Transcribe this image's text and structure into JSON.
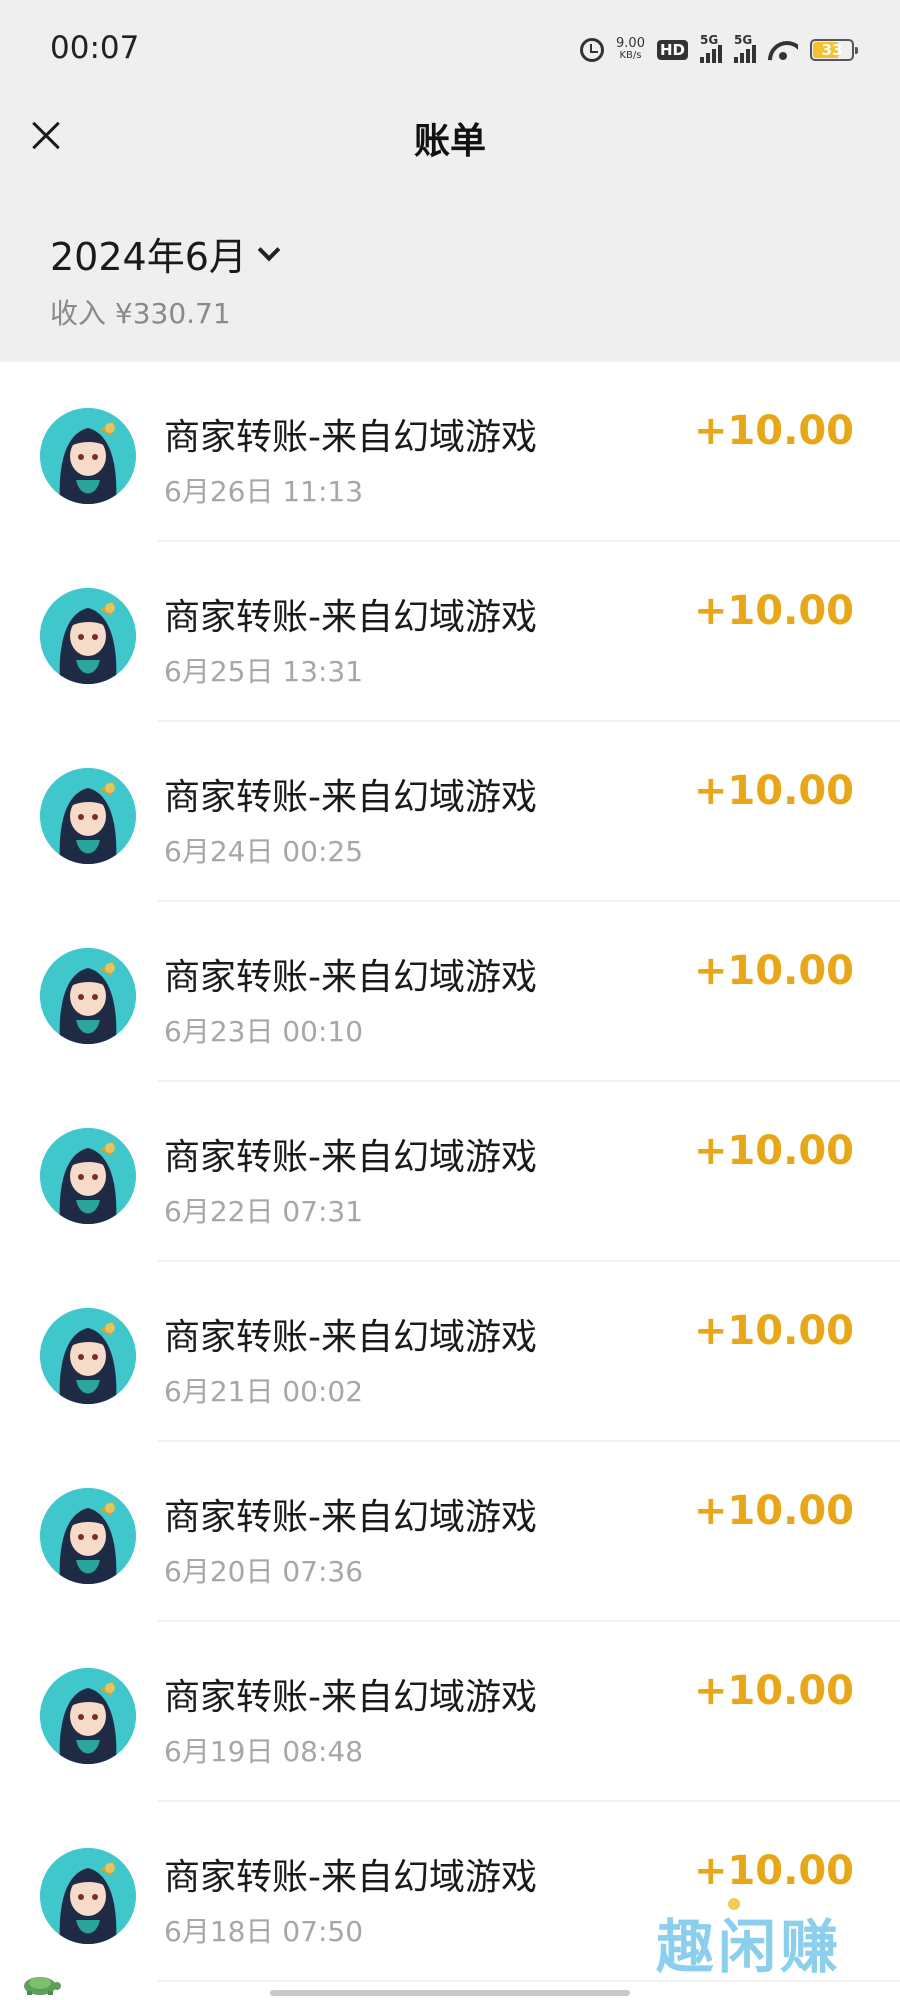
{
  "status_bar": {
    "time": "00:07",
    "net_speed_value": "9.00",
    "net_speed_unit": "KB/s",
    "hd_label": "HD",
    "sim1_label": "5G",
    "sim2_label": "5G",
    "battery_level": "33"
  },
  "header": {
    "title": "账单"
  },
  "summary": {
    "month": "2024年6月",
    "income": "收入 ¥330.71"
  },
  "transactions": [
    {
      "title": "商家转账-来自幻域游戏",
      "time": "6月26日 11:13",
      "amount": "+10.00"
    },
    {
      "title": "商家转账-来自幻域游戏",
      "time": "6月25日 13:31",
      "amount": "+10.00"
    },
    {
      "title": "商家转账-来自幻域游戏",
      "time": "6月24日 00:25",
      "amount": "+10.00"
    },
    {
      "title": "商家转账-来自幻域游戏",
      "time": "6月23日 00:10",
      "amount": "+10.00"
    },
    {
      "title": "商家转账-来自幻域游戏",
      "time": "6月22日 07:31",
      "amount": "+10.00"
    },
    {
      "title": "商家转账-来自幻域游戏",
      "time": "6月21日 00:02",
      "amount": "+10.00"
    },
    {
      "title": "商家转账-来自幻域游戏",
      "time": "6月20日 07:36",
      "amount": "+10.00"
    },
    {
      "title": "商家转账-来自幻域游戏",
      "time": "6月19日 08:48",
      "amount": "+10.00"
    },
    {
      "title": "商家转账-来自幻域游戏",
      "time": "6月18日 07:50",
      "amount": "+10.00"
    }
  ],
  "watermark": "趣闲赚",
  "colors": {
    "amount": "#e8a718",
    "header_bg": "#efefef",
    "avatar_bg": "#3fc7cb",
    "watermark": "#7fcaeb"
  },
  "icons": {
    "close": "close-icon",
    "month_dropdown": "chevron-down-icon",
    "alarm": "alarm-icon",
    "wifi": "wifi-icon",
    "battery": "battery-icon"
  }
}
